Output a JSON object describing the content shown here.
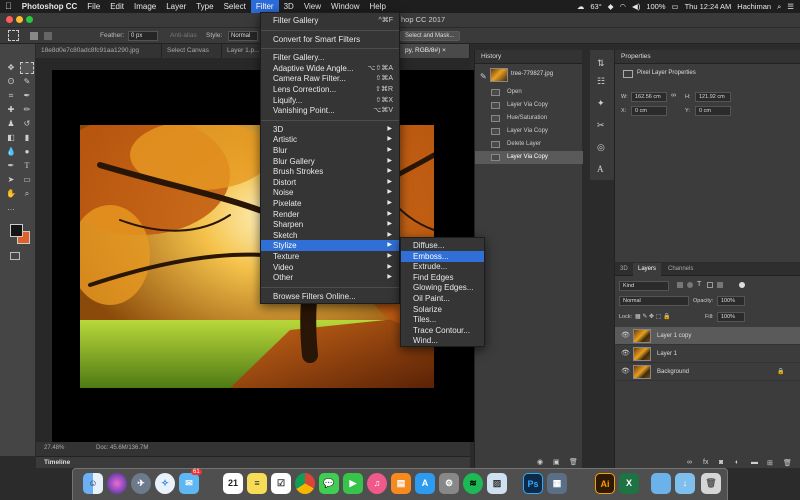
{
  "mac_menubar": {
    "items": [
      "Photoshop CC",
      "File",
      "Edit",
      "Image",
      "Layer",
      "Type",
      "Select",
      "Filter",
      "3D",
      "View",
      "Window",
      "Help"
    ],
    "active": "Filter",
    "status": {
      "temp": "63°",
      "battery": "100%",
      "clock": "Thu 12:24 AM",
      "user": "Hachiman"
    }
  },
  "titlebar": {
    "title_visible": "hop CC 2017"
  },
  "options_bar": {
    "feather_label": "Feather:",
    "feather_value": "0 px",
    "anti_alias_label": "Anti-alias",
    "style_label": "Style:",
    "style_value": "Normal",
    "select_mask_button": "Select and Mask..."
  },
  "doc_tabs": [
    {
      "label": "18e8d0e7c80adc8fc91aa1290.jpg"
    },
    {
      "label": "Select Canvas"
    },
    {
      "label": "Layer 1.p..."
    },
    {
      "label": "py, RGB/8#) ×",
      "active": true
    }
  ],
  "status_bar": {
    "zoom": "27.48%",
    "doc": "Doc: 45.6M/136.7M"
  },
  "timeline_label": "Timeline",
  "filter_menu": {
    "items": [
      {
        "label": "Filter Gallery",
        "shortcut": "^⌘F"
      },
      {
        "sep": true
      },
      {
        "label": "Convert for Smart Filters"
      },
      {
        "sep": true
      },
      {
        "label": "Filter Gallery..."
      },
      {
        "label": "Adaptive Wide Angle...",
        "shortcut": "⌥⇧⌘A"
      },
      {
        "label": "Camera Raw Filter...",
        "shortcut": "⇧⌘A"
      },
      {
        "label": "Lens Correction...",
        "shortcut": "⇧⌘R"
      },
      {
        "label": "Liquify...",
        "shortcut": "⇧⌘X"
      },
      {
        "label": "Vanishing Point...",
        "shortcut": "⌥⌘V"
      },
      {
        "sep": true
      },
      {
        "label": "3D",
        "submenu": true
      },
      {
        "label": "Artistic",
        "submenu": true
      },
      {
        "label": "Blur",
        "submenu": true
      },
      {
        "label": "Blur Gallery",
        "submenu": true
      },
      {
        "label": "Brush Strokes",
        "submenu": true
      },
      {
        "label": "Distort",
        "submenu": true
      },
      {
        "label": "Noise",
        "submenu": true
      },
      {
        "label": "Pixelate",
        "submenu": true
      },
      {
        "label": "Render",
        "submenu": true
      },
      {
        "label": "Sharpen",
        "submenu": true
      },
      {
        "label": "Sketch",
        "submenu": true
      },
      {
        "label": "Stylize",
        "submenu": true,
        "highlight": true
      },
      {
        "label": "Texture",
        "submenu": true
      },
      {
        "label": "Video",
        "submenu": true
      },
      {
        "label": "Other",
        "submenu": true
      },
      {
        "sep": true
      },
      {
        "label": "Browse Filters Online..."
      }
    ]
  },
  "stylize_submenu": {
    "items": [
      {
        "label": "Diffuse..."
      },
      {
        "label": "Emboss...",
        "highlight": true
      },
      {
        "label": "Extrude..."
      },
      {
        "label": "Find Edges"
      },
      {
        "label": "Glowing Edges..."
      },
      {
        "label": "Oil Paint..."
      },
      {
        "label": "Solarize"
      },
      {
        "label": "Tiles..."
      },
      {
        "label": "Trace Contour..."
      },
      {
        "label": "Wind..."
      }
    ]
  },
  "history_panel": {
    "title": "History",
    "snapshot": "tree-779827.jpg",
    "items": [
      {
        "label": "Open"
      },
      {
        "label": "Layer Via Copy"
      },
      {
        "label": "Hue/Saturation"
      },
      {
        "label": "Layer Via Copy"
      },
      {
        "label": "Delete Layer"
      },
      {
        "label": "Layer Via Copy",
        "selected": true
      }
    ]
  },
  "properties_panel": {
    "title": "Properties",
    "subtitle": "Pixel Layer Properties",
    "w_label": "W:",
    "w_value": "162.56 cm",
    "h_label": "H:",
    "h_value": "121.92 cm",
    "x_label": "X:",
    "x_value": "0 cm",
    "y_label": "Y:",
    "y_value": "0 cm"
  },
  "layers_panel": {
    "tabs": [
      "3D",
      "Layers",
      "Channels"
    ],
    "active_tab": "Layers",
    "kind_label": "Kind",
    "blend_mode": "Normal",
    "opacity_label": "Opacity:",
    "opacity_value": "100%",
    "lock_label": "Lock:",
    "fill_label": "Fill:",
    "fill_value": "100%",
    "layers": [
      {
        "name": "Layer 1 copy",
        "selected": true
      },
      {
        "name": "Layer 1"
      },
      {
        "name": "Background",
        "locked": true
      }
    ]
  },
  "dock": {
    "badge_count": "61",
    "calendar_day": "21",
    "apps": [
      "finder",
      "siri",
      "launchpad",
      "safari",
      "mail",
      "calendar",
      "notes",
      "reminders",
      "chrome",
      "messages",
      "facetime",
      "itunes",
      "ibooks",
      "app-store",
      "system-preferences",
      "spotify",
      "preview",
      "photoshop",
      "illustrator",
      "excel",
      "folder",
      "downloads",
      "trash"
    ],
    "icon_labels": {
      "photoshop": "Ps",
      "illustrator": "Ai",
      "excel": "X"
    }
  }
}
